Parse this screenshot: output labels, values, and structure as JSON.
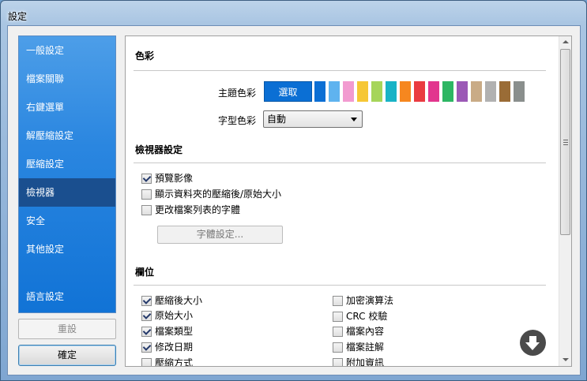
{
  "window": {
    "title": "設定"
  },
  "sidebar": {
    "items": [
      {
        "label": "一般設定"
      },
      {
        "label": "檔案關聯"
      },
      {
        "label": "右鍵選單"
      },
      {
        "label": "解壓縮設定"
      },
      {
        "label": "壓縮設定"
      },
      {
        "label": "檢視器",
        "active": true
      },
      {
        "label": "安全"
      },
      {
        "label": "其他設定"
      },
      {
        "label": "語言設定"
      }
    ]
  },
  "buttons": {
    "reset": "重設",
    "ok": "確定"
  },
  "color_section": {
    "title": "色彩",
    "theme_label": "主題色彩",
    "choose_label": "選取",
    "swatches": [
      "#0b6fd4",
      "#5fb3ef",
      "#f29ad0",
      "#f6c735",
      "#a6d55a",
      "#19b3c6",
      "#f6871f",
      "#ea3b41",
      "#e2358e",
      "#2db663",
      "#9b59b6",
      "#c9ab86",
      "#b1b1b1",
      "#9a6c36",
      "#8a8f8d"
    ],
    "font_label": "字型色彩",
    "font_value": "自動"
  },
  "viewer_section": {
    "title": "檢視器設定",
    "options": [
      {
        "label": "預覽影像",
        "checked": true
      },
      {
        "label": "顯示資料夾的壓縮後/原始大小",
        "checked": false
      },
      {
        "label": "更改檔案列表的字體",
        "checked": false
      }
    ],
    "font_button": "字體設定..."
  },
  "columns_section": {
    "title": "欄位",
    "left": [
      {
        "label": "壓縮後大小",
        "checked": true
      },
      {
        "label": "原始大小",
        "checked": true
      },
      {
        "label": "檔案類型",
        "checked": true
      },
      {
        "label": "修改日期",
        "checked": true
      },
      {
        "label": "壓縮方式",
        "checked": false
      }
    ],
    "right": [
      {
        "label": "加密演算法",
        "checked": false
      },
      {
        "label": "CRC 校驗",
        "checked": false
      },
      {
        "label": "檔案內容",
        "checked": false
      },
      {
        "label": "檔案註解",
        "checked": false
      },
      {
        "label": "附加資訊",
        "checked": false
      }
    ]
  }
}
